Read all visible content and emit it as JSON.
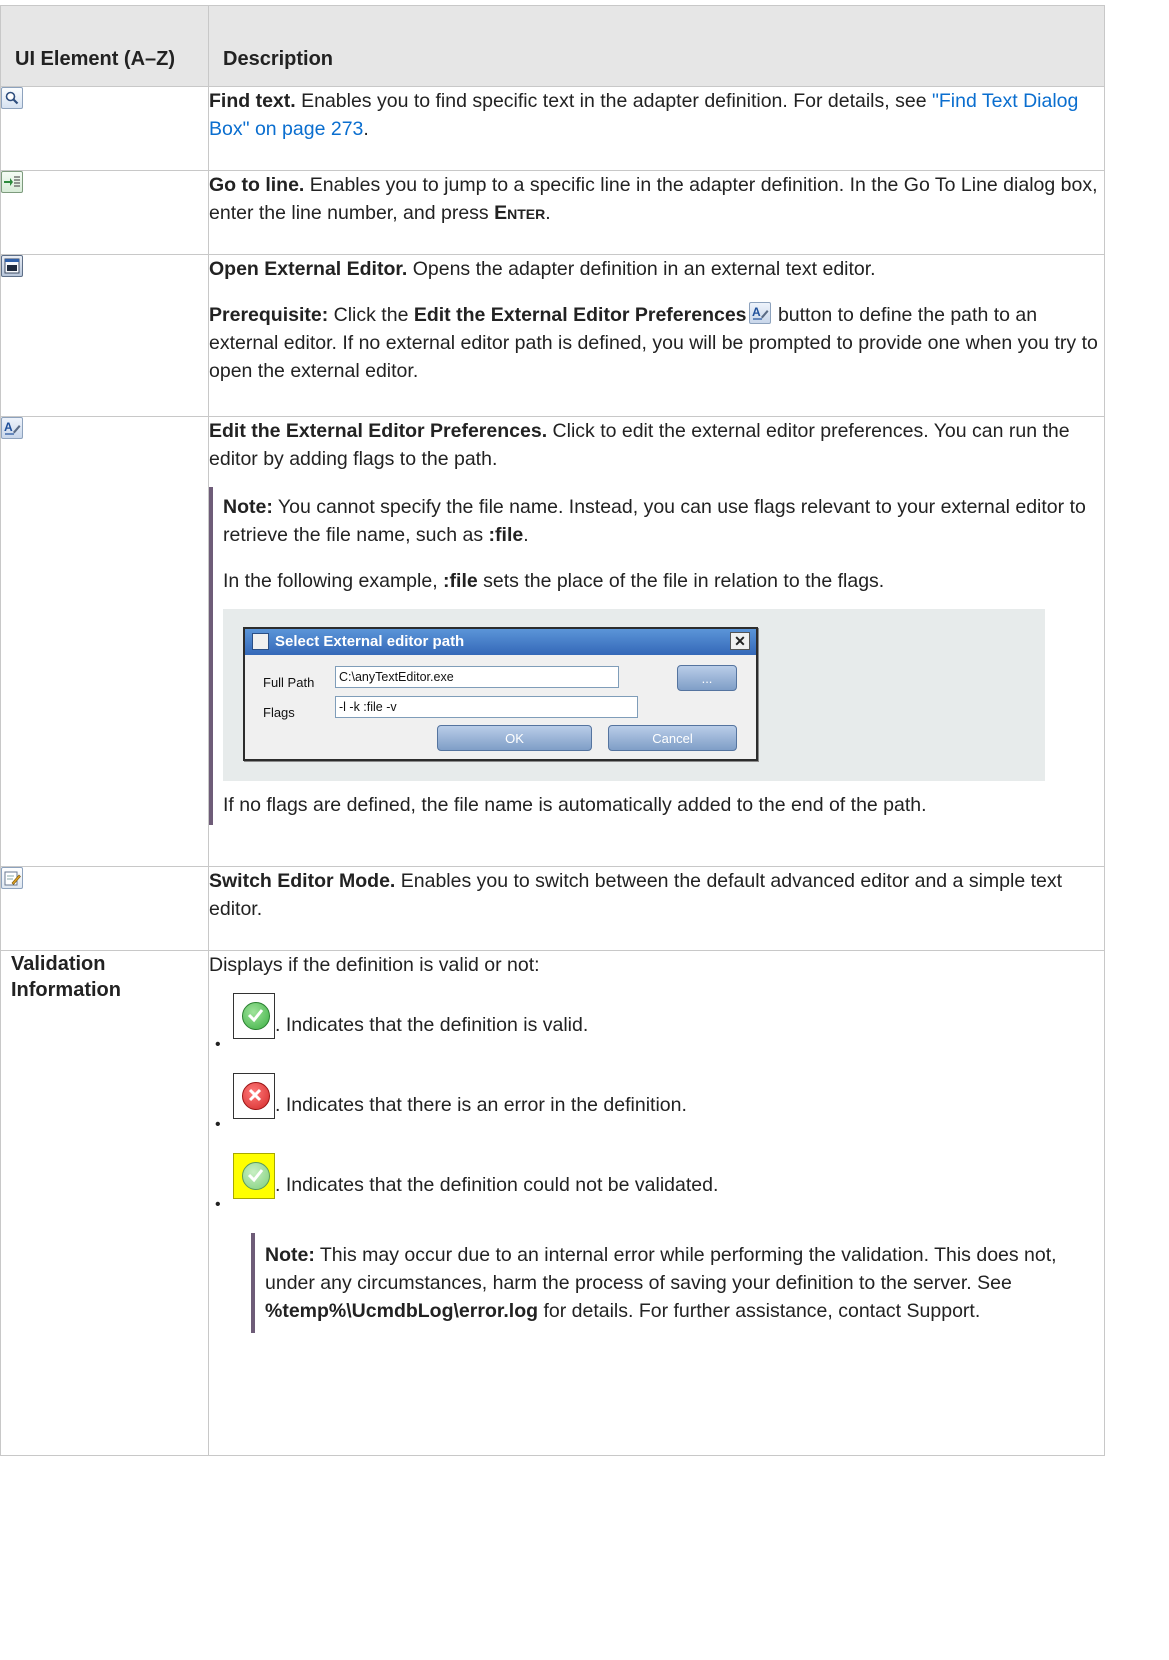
{
  "table": {
    "header": {
      "col1": "UI Element (A–Z)",
      "col2": "Description"
    },
    "rows": [
      {
        "icon": "magnifier-icon",
        "title": "Find text.",
        "text": " Enables you to find specific text in the adapter definition. For details, see ",
        "link": "\"Find Text Dialog Box\" on page 273",
        "end": "."
      },
      {
        "icon": "go-to-line-icon",
        "title": "Go to line.",
        "text": " Enables you to jump to a specific line in the adapter definition. In the Go To Line dialog box, enter the line number, and press ",
        "key": "Enter",
        "end": "."
      },
      {
        "icon": "external-editor-icon",
        "title": "Open External Editor.",
        "text": " Opens the adapter definition in an external text editor.",
        "prereq_label": "Prerequisite:",
        "prereq_pre": " Click the ",
        "prereq_bold": "Edit the External Editor Preferences",
        "prereq_post": " button to define the path to an external editor. If no external editor path is defined, you will be prompted to provide one when you try to open the external editor."
      },
      {
        "icon": "editor-preferences-icon",
        "title": "Edit the External Editor Preferences.",
        "text": " Click to edit the external editor preferences. You can run the editor by adding flags to the path.",
        "note_label": "Note:",
        "note_text": "  You cannot specify the file name. Instead, you can use flags relevant to your external editor to retrieve the file name, such as ",
        "note_code": ":file",
        "note_end": ".",
        "example_pre": "In the following example, ",
        "example_code": ":file",
        "example_post": " sets the place of the file in relation to the flags.",
        "dialog": {
          "title": "Select External editor path",
          "close": "✕",
          "full_path_label": "Full Path",
          "full_path_value": "C:\\anyTextEditor.exe",
          "browse": "...",
          "flags_label": "Flags",
          "flags_value": "-l -k :file -v",
          "ok": "OK",
          "cancel": "Cancel"
        },
        "after_dialog": "If no flags are defined, the file name is automatically added to the end of the path."
      },
      {
        "icon": "switch-editor-mode-icon",
        "title": "Switch Editor Mode.",
        "text": " Enables you to switch between the default advanced editor and a simple text editor."
      },
      {
        "element_label": "Validation Information",
        "intro": "Displays if the definition is valid or not:",
        "items": [
          {
            "icon": "valid-check-icon",
            "text": ". Indicates that the definition is valid."
          },
          {
            "icon": "error-x-icon",
            "text": ". Indicates that there is an error in the definition."
          },
          {
            "icon": "not-validated-icon",
            "text": ". Indicates that the definition could not be validated."
          }
        ],
        "note_label": "Note:",
        "note_text": "  This may occur due to an internal error while performing the validation. This does not, under any circumstances, harm the process of saving your definition to the server. See ",
        "note_path": "%temp%\\UcmdbLog\\error.log",
        "note_end": " for details. For further assistance, contact Support."
      }
    ]
  },
  "colors": {
    "link": "#0a6ecf",
    "note_bar": "#6e5c78",
    "header_bg": "#e6e6e6",
    "valid_green": "#3cb043",
    "error_red": "#d42a2a",
    "not_validated_bg": "#ffff00"
  }
}
